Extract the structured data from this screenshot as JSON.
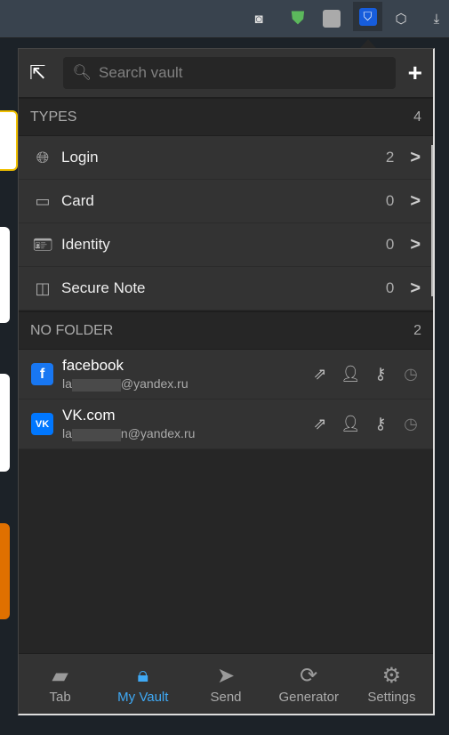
{
  "header": {
    "search_placeholder": "Search vault"
  },
  "types": {
    "title": "TYPES",
    "count": "4",
    "items": [
      {
        "label": "Login",
        "count": "2"
      },
      {
        "label": "Card",
        "count": "0"
      },
      {
        "label": "Identity",
        "count": "0"
      },
      {
        "label": "Secure Note",
        "count": "0"
      }
    ]
  },
  "no_folder": {
    "title": "NO FOLDER",
    "count": "2",
    "items": [
      {
        "name": "facebook",
        "user_prefix": "la",
        "user_suffix": "@yandex.ru",
        "color": "#1877f2",
        "icon": "f"
      },
      {
        "name": "VK.com",
        "user_prefix": "la",
        "user_suffix": "n@yandex.ru",
        "color": "#0077ff",
        "icon": "vk"
      }
    ]
  },
  "nav": [
    {
      "label": "Tab"
    },
    {
      "label": "My Vault"
    },
    {
      "label": "Send"
    },
    {
      "label": "Generator"
    },
    {
      "label": "Settings"
    }
  ],
  "colors": {
    "accent": "#3fa9f5",
    "bitwarden": "#175ddc"
  }
}
